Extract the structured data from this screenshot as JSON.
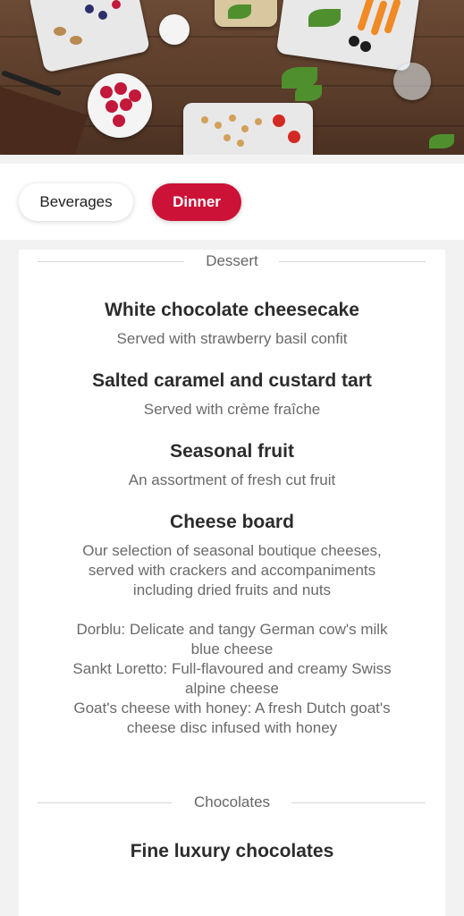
{
  "hero": {
    "image_icon": "food-spread-photo"
  },
  "tabs": [
    {
      "label": "Beverages",
      "active": false
    },
    {
      "label": "Dinner",
      "active": true
    }
  ],
  "colors": {
    "accent": "#cc1236",
    "background": "#f2f2f2",
    "card": "#ffffff"
  },
  "sections": [
    {
      "title": "Dessert",
      "items": [
        {
          "name": "White chocolate cheesecake",
          "description": [
            "Served with strawberry basil confit"
          ]
        },
        {
          "name": "Salted caramel and custard tart",
          "description": [
            "Served with crème fraîche"
          ]
        },
        {
          "name": "Seasonal fruit",
          "description": [
            "An assortment of fresh cut fruit"
          ]
        },
        {
          "name": "Cheese board",
          "description": [
            "Our selection of seasonal boutique cheeses,",
            "served with crackers and accompaniments",
            "including dried fruits and nuts",
            "",
            "Dorblu: Delicate and tangy German cow's milk",
            "blue cheese",
            "Sankt Loretto: Full-flavoured and creamy Swiss",
            "alpine cheese",
            "Goat's cheese with honey: A fresh Dutch goat's",
            "cheese disc infused with honey"
          ]
        }
      ]
    },
    {
      "title": "Chocolates",
      "items": [
        {
          "name": "Fine luxury chocolates",
          "description": []
        }
      ]
    }
  ]
}
